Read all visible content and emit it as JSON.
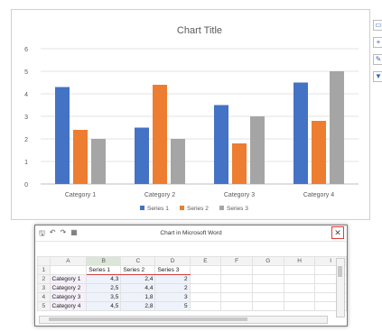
{
  "chart_data": {
    "type": "bar",
    "title": "Chart Title",
    "categories": [
      "Category 1",
      "Category 2",
      "Category 3",
      "Category 4"
    ],
    "series": [
      {
        "name": "Series 1",
        "values": [
          4.3,
          2.5,
          3.5,
          4.5
        ],
        "color": "#4472c4"
      },
      {
        "name": "Series 2",
        "values": [
          2.4,
          4.4,
          1.8,
          2.8
        ],
        "color": "#ed7d31"
      },
      {
        "name": "Series 3",
        "values": [
          2,
          2,
          3,
          5
        ],
        "color": "#a5a5a5"
      }
    ],
    "ylim": [
      0,
      6
    ],
    "yticks": [
      "0",
      "1",
      "2",
      "3",
      "4",
      "5",
      "6"
    ],
    "grid": true,
    "legend_position": "bottom"
  },
  "side_tools": [
    "layout-icon",
    "plus-icon",
    "brush-icon",
    "filter-icon"
  ],
  "sheet_window": {
    "title": "Chart in Microsoft Word",
    "close_label": "✕",
    "qat": {
      "save": "🖫",
      "undo": "↶",
      "redo": "↷",
      "sheet": "▦"
    },
    "col_headers": [
      "A",
      "B",
      "C",
      "D",
      "E",
      "F",
      "G",
      "H",
      "I"
    ],
    "row_numbers": [
      "1",
      "2",
      "3",
      "4",
      "5"
    ],
    "header_row": [
      "",
      "Series 1",
      "Series 2",
      "Series 3"
    ],
    "rows": [
      [
        "Category 1",
        "4,3",
        "2,4",
        "2"
      ],
      [
        "Category 2",
        "2,5",
        "4,4",
        "2"
      ],
      [
        "Category 3",
        "3,5",
        "1,8",
        "3"
      ],
      [
        "Category 4",
        "4,5",
        "2,8",
        "5"
      ]
    ]
  }
}
